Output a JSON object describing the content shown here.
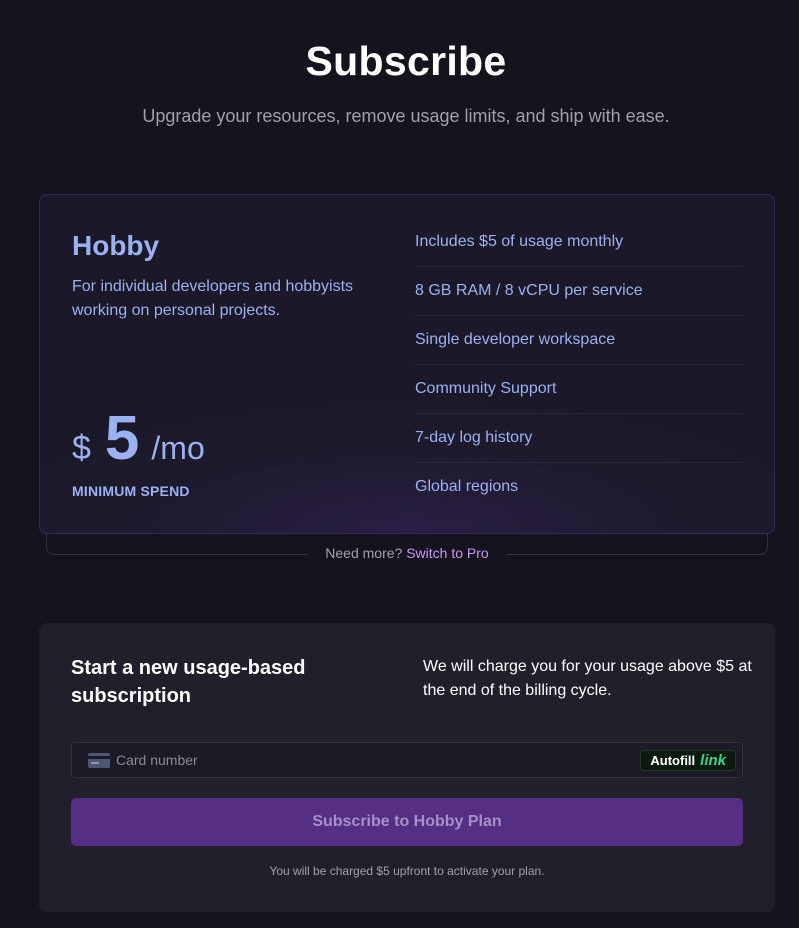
{
  "header": {
    "title": "Subscribe",
    "subtitle": "Upgrade your resources, remove usage limits, and ship with ease."
  },
  "plan": {
    "name": "Hobby",
    "description": "For individual developers and hobbyists working on personal projects.",
    "price": {
      "currency": "$",
      "amount": "5",
      "period": "/mo"
    },
    "price_note": "MINIMUM SPEND",
    "features": [
      "Includes $5 of usage monthly",
      "8 GB RAM / 8 vCPU per service",
      "Single developer workspace",
      "Community Support",
      "7-day log history",
      "Global regions"
    ]
  },
  "upsell": {
    "prefix": "Need more?",
    "link": "Switch to Pro"
  },
  "subscription": {
    "heading": "Start a new usage-based subscription",
    "note": "We will charge you for your usage above $5 at the end of the billing cycle.",
    "card_input": {
      "placeholder": "Card number",
      "icon": "credit-card-icon"
    },
    "autofill": {
      "label": "Autofill",
      "brand": "link"
    },
    "submit_label": "Subscribe to Hobby Plan",
    "footnote": "You will be charged $5 upfront to activate your plan."
  },
  "colors": {
    "background": "#15131d",
    "accent_text": "#9bb1f2",
    "link_purple": "#c69af2",
    "button_bg": "#552f83",
    "autofill_green": "#3fd28a"
  }
}
